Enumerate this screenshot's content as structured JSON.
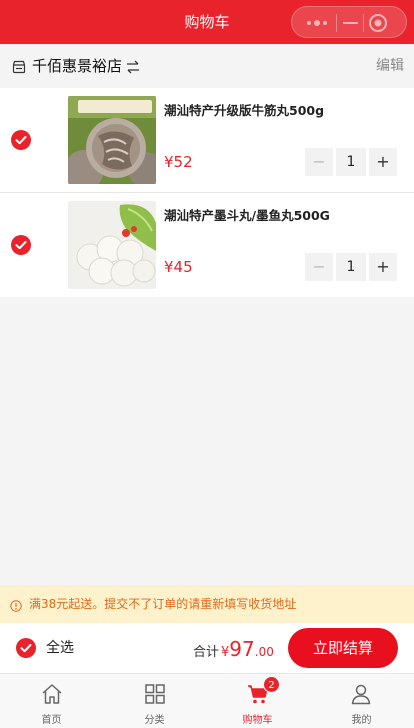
{
  "header": {
    "title": "购物车"
  },
  "store": {
    "name": "千佰惠景裕店",
    "edit_label": "编辑"
  },
  "items": [
    {
      "name": "潮汕特产升级版牛筋丸500g",
      "price": "¥52",
      "quantity": "1",
      "minus": "−",
      "plus": "+"
    },
    {
      "name": "潮汕特产墨斗丸/墨鱼丸500G",
      "price": "¥45",
      "quantity": "1",
      "minus": "−",
      "plus": "+"
    }
  ],
  "notice": {
    "text": "满38元起送。提交不了订单的请重新填写收货地址"
  },
  "footer": {
    "select_all": "全选",
    "total_label": "合计",
    "total_currency": "¥",
    "total_integer": "97",
    "total_decimal": ".00",
    "checkout_label": "立即结算"
  },
  "tabbar": {
    "tabs": [
      {
        "label": "首页",
        "icon": "home-icon"
      },
      {
        "label": "分类",
        "icon": "category-icon"
      },
      {
        "label": "购物车",
        "icon": "cart-icon",
        "badge": "2"
      },
      {
        "label": "我的",
        "icon": "user-icon"
      }
    ]
  },
  "colors": {
    "brand": "#e8232c",
    "notice_bg": "#fdf2cc",
    "notice_text": "#e06a1a"
  }
}
